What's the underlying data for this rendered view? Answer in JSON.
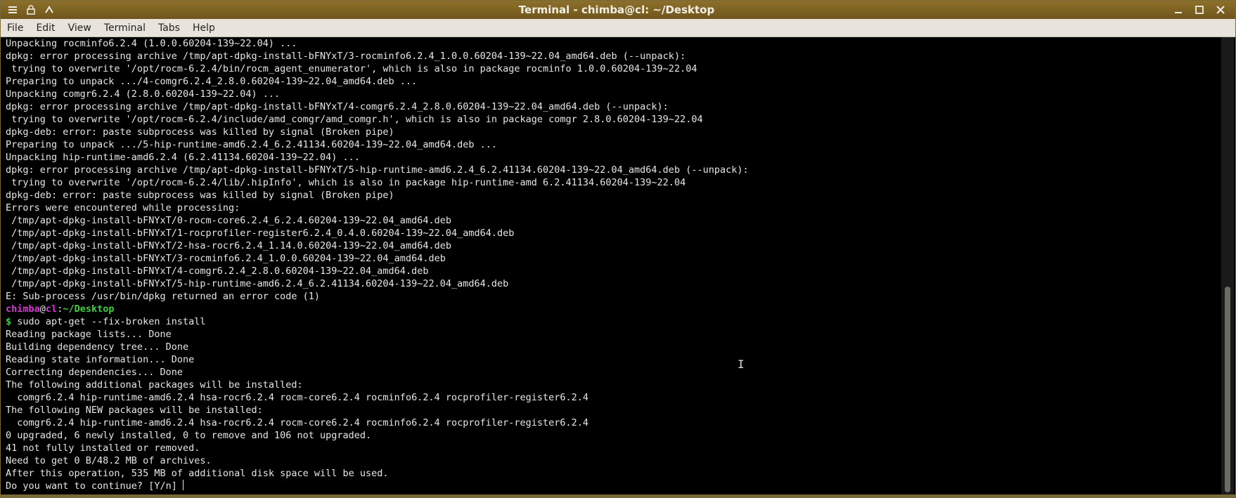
{
  "window": {
    "title": "Terminal - chimba@cl: ~/Desktop"
  },
  "titlebar": {
    "left_icons": [
      "menu-icon",
      "lock-icon",
      "up-arrow-icon"
    ],
    "right_icons": [
      "minimize-icon",
      "maximize-icon",
      "close-icon"
    ]
  },
  "menubar": {
    "items": [
      "File",
      "Edit",
      "View",
      "Terminal",
      "Tabs",
      "Help"
    ]
  },
  "terminal": {
    "lines_before": [
      "Unpacking rocminfo6.2.4 (1.0.0.60204-139~22.04) ...",
      "dpkg: error processing archive /tmp/apt-dpkg-install-bFNYxT/3-rocminfo6.2.4_1.0.0.60204-139~22.04_amd64.deb (--unpack):",
      " trying to overwrite '/opt/rocm-6.2.4/bin/rocm_agent_enumerator', which is also in package rocminfo 1.0.0.60204-139~22.04",
      "Preparing to unpack .../4-comgr6.2.4_2.8.0.60204-139~22.04_amd64.deb ...",
      "Unpacking comgr6.2.4 (2.8.0.60204-139~22.04) ...",
      "dpkg: error processing archive /tmp/apt-dpkg-install-bFNYxT/4-comgr6.2.4_2.8.0.60204-139~22.04_amd64.deb (--unpack):",
      " trying to overwrite '/opt/rocm-6.2.4/include/amd_comgr/amd_comgr.h', which is also in package comgr 2.8.0.60204-139~22.04",
      "dpkg-deb: error: paste subprocess was killed by signal (Broken pipe)",
      "Preparing to unpack .../5-hip-runtime-amd6.2.4_6.2.41134.60204-139~22.04_amd64.deb ...",
      "Unpacking hip-runtime-amd6.2.4 (6.2.41134.60204-139~22.04) ...",
      "dpkg: error processing archive /tmp/apt-dpkg-install-bFNYxT/5-hip-runtime-amd6.2.4_6.2.41134.60204-139~22.04_amd64.deb (--unpack):",
      " trying to overwrite '/opt/rocm-6.2.4/lib/.hipInfo', which is also in package hip-runtime-amd 6.2.41134.60204-139~22.04",
      "dpkg-deb: error: paste subprocess was killed by signal (Broken pipe)",
      "Errors were encountered while processing:",
      " /tmp/apt-dpkg-install-bFNYxT/0-rocm-core6.2.4_6.2.4.60204-139~22.04_amd64.deb",
      " /tmp/apt-dpkg-install-bFNYxT/1-rocprofiler-register6.2.4_0.4.0.60204-139~22.04_amd64.deb",
      " /tmp/apt-dpkg-install-bFNYxT/2-hsa-rocr6.2.4_1.14.0.60204-139~22.04_amd64.deb",
      " /tmp/apt-dpkg-install-bFNYxT/3-rocminfo6.2.4_1.0.0.60204-139~22.04_amd64.deb",
      " /tmp/apt-dpkg-install-bFNYxT/4-comgr6.2.4_2.8.0.60204-139~22.04_amd64.deb",
      " /tmp/apt-dpkg-install-bFNYxT/5-hip-runtime-amd6.2.4_6.2.41134.60204-139~22.04_amd64.deb",
      "E: Sub-process /usr/bin/dpkg returned an error code (1)"
    ],
    "prompt": {
      "user": "chimba",
      "at": "@",
      "host": "cl",
      "sep": ":",
      "path": "~/Desktop",
      "dollar": "$",
      "command": " sudo apt-get --fix-broken install"
    },
    "lines_after": [
      "Reading package lists... Done",
      "Building dependency tree... Done",
      "Reading state information... Done",
      "Correcting dependencies... Done",
      "The following additional packages will be installed:",
      "  comgr6.2.4 hip-runtime-amd6.2.4 hsa-rocr6.2.4 rocm-core6.2.4 rocminfo6.2.4 rocprofiler-register6.2.4",
      "The following NEW packages will be installed:",
      "  comgr6.2.4 hip-runtime-amd6.2.4 hsa-rocr6.2.4 rocm-core6.2.4 rocminfo6.2.4 rocprofiler-register6.2.4",
      "0 upgraded, 6 newly installed, 0 to remove and 106 not upgraded.",
      "41 not fully installed or removed.",
      "Need to get 0 B/48.2 MB of archives.",
      "After this operation, 535 MB of additional disk space will be used."
    ],
    "final_prompt": "Do you want to continue? [Y/n] "
  }
}
